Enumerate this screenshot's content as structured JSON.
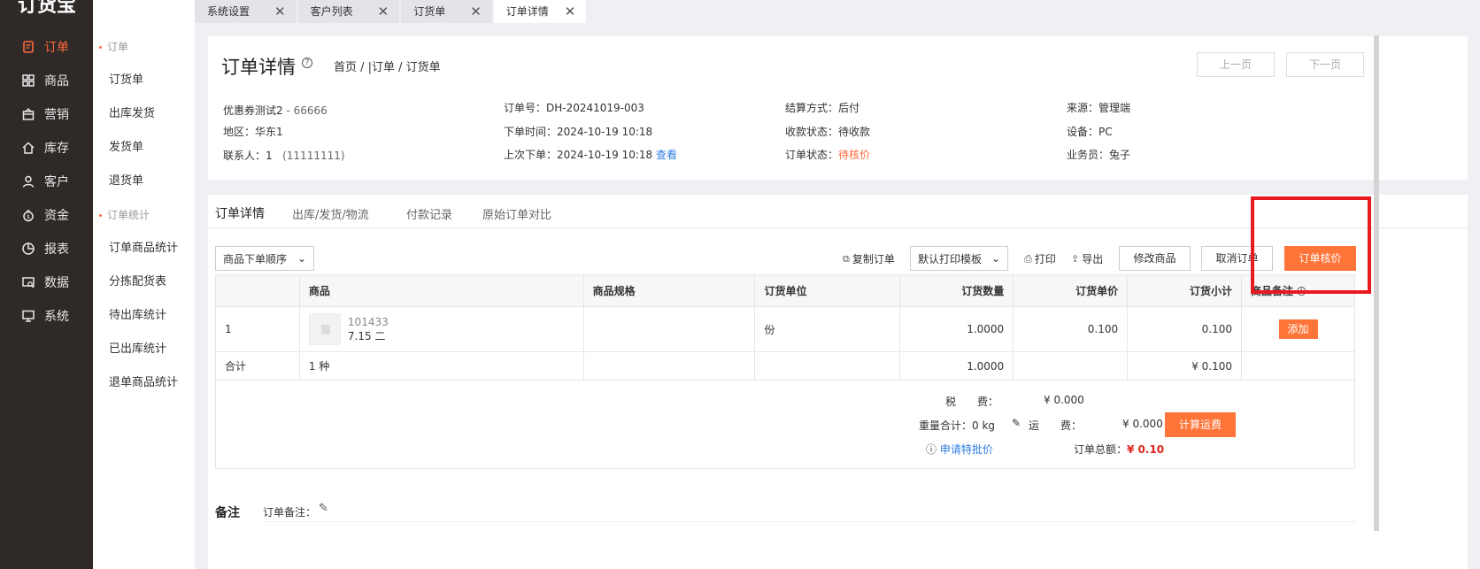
{
  "app": {
    "logo": "订货宝"
  },
  "nav": [
    {
      "label": "订单",
      "icon": "order-icon",
      "active": true
    },
    {
      "label": "商品",
      "icon": "grid-icon"
    },
    {
      "label": "营销",
      "icon": "gift-icon"
    },
    {
      "label": "库存",
      "icon": "home-icon"
    },
    {
      "label": "客户",
      "icon": "user-icon"
    },
    {
      "label": "资金",
      "icon": "money-bag-icon"
    },
    {
      "label": "报表",
      "icon": "pie-chart-icon"
    },
    {
      "label": "数据",
      "icon": "data-icon"
    },
    {
      "label": "系统",
      "icon": "monitor-icon"
    }
  ],
  "submenu": {
    "group1": "订单",
    "items1": [
      "订货单",
      "出库发货",
      "发货单",
      "退货单"
    ],
    "group2": "订单统计",
    "items2": [
      "订单商品统计",
      "分拣配货表",
      "待出库统计",
      "已出库统计",
      "退单商品统计"
    ]
  },
  "tabs": [
    {
      "label": "系统设置"
    },
    {
      "label": "客户列表"
    },
    {
      "label": "订货单"
    },
    {
      "label": "订单详情",
      "active": true
    }
  ],
  "header": {
    "title": "订单详情",
    "breadcrumb": "首页 / |订单 / 订货单",
    "prev": "上一页",
    "next": "下一页"
  },
  "info": {
    "customer": "优惠券测试2",
    "customer_code": " - 66666",
    "region": "地区：华东1",
    "contact_label": "联系人：",
    "contact_name": "1",
    "contact_phone": "(11111111)",
    "order_no": "订单号：DH-20241019-003",
    "order_time": "下单时间：2024-10-19 10:18",
    "last_order": "上次下单：2024-10-19 10:18",
    "view_link": "查看",
    "settlement": "结算方式：后付",
    "payment_status": "收款状态：待收款",
    "order_status_label": "订单状态：",
    "order_status": "待核价",
    "source": "来源：管理端",
    "device": "设备：PC",
    "salesman": "业务员：兔子"
  },
  "detail_tabs": [
    "订单详情",
    "出库/发货/物流",
    "付款记录",
    "原始订单对比"
  ],
  "toolbar": {
    "sort_select": "商品下单顺序",
    "copy_order": "复制订单",
    "print_template": "默认打印模板",
    "print": "打印",
    "export": "导出",
    "modify_goods": "修改商品",
    "cancel_order": "取消订单",
    "price_check": "订单核价"
  },
  "table": {
    "headers": [
      "",
      "商品",
      "商品规格",
      "订货单位",
      "订货数量",
      "订货单价",
      "订货小计",
      "商品备注"
    ],
    "rows": [
      {
        "index": "1",
        "code": "101433",
        "name": "7.15 二",
        "spec": "",
        "unit": "份",
        "qty": "1.0000",
        "price": "0.100",
        "subtotal": "0.100",
        "action": "添加"
      }
    ],
    "sum": {
      "label": "合计",
      "kinds": "1 种",
      "qty": "1.0000",
      "subtotal": "¥ 0.100"
    }
  },
  "totals": {
    "tax_label": "税　　费：",
    "tax_value": "¥ 0.000",
    "weight": "重量合计：0 kg",
    "freight_label": "运　　费：",
    "freight_value": "¥ 0.000",
    "calc_freight": "计算运费",
    "apply_special": "申请特批价",
    "total_label": "订单总额：",
    "currency": "¥ ",
    "total_value": "0.10"
  },
  "remark": {
    "title": "备注",
    "label": "订单备注："
  },
  "colors": {
    "accent": "#ff7438",
    "nav_bg": "#2f2a28",
    "link": "#2d7ce0",
    "highlight": "#e8191f"
  }
}
